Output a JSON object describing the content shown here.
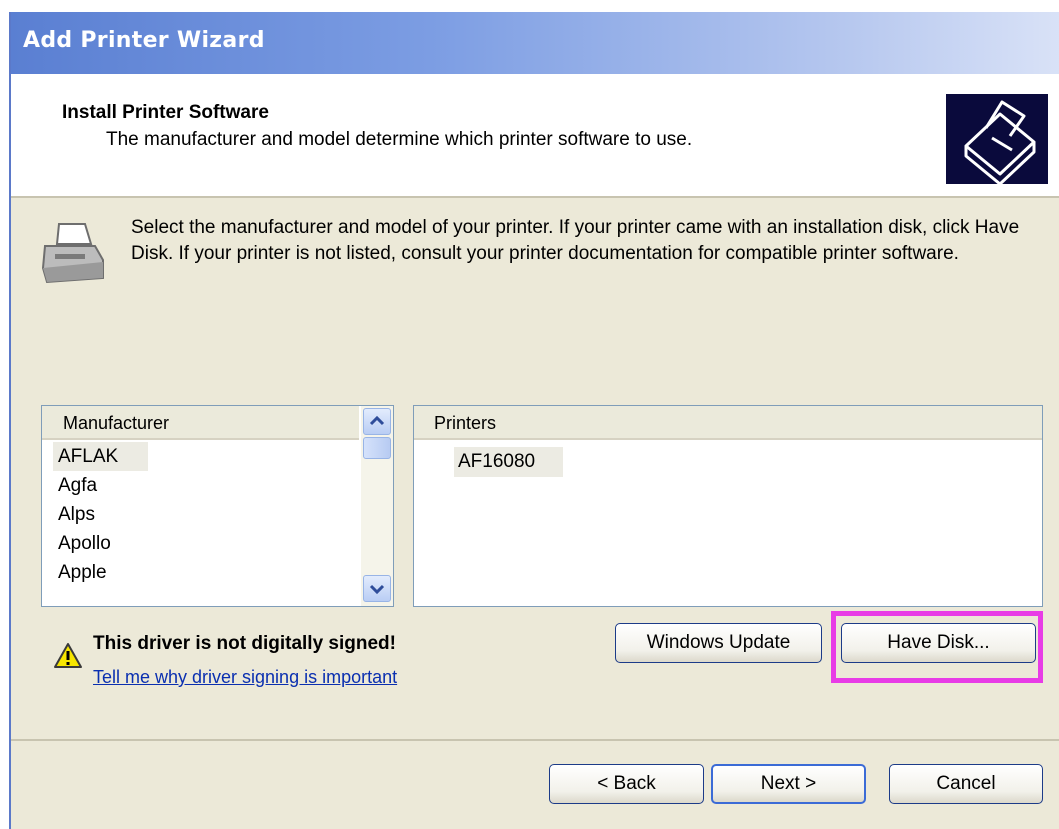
{
  "window": {
    "title": "Add Printer Wizard"
  },
  "header": {
    "title": "Install Printer Software",
    "subtitle": "The manufacturer and model determine which printer software to use.",
    "icon": "printer-wizard-graphic"
  },
  "intro": {
    "icon": "printer-icon",
    "text": "Select the manufacturer and model of your printer. If your printer came with an installation disk, click Have Disk. If your printer is not listed, consult your printer documentation for compatible printer software."
  },
  "manufacturer_list": {
    "header": "Manufacturer",
    "items": [
      {
        "label": "AFLAK",
        "selected": true
      },
      {
        "label": "Agfa"
      },
      {
        "label": "Alps"
      },
      {
        "label": "Apollo"
      },
      {
        "label": "Apple"
      }
    ]
  },
  "printers_list": {
    "header": "Printers",
    "items": [
      {
        "label": "AF16080",
        "selected": true
      }
    ]
  },
  "warning": {
    "icon": "warning-icon",
    "text": "This driver is not digitally signed!",
    "link": "Tell me why driver signing is important"
  },
  "buttons": {
    "windows_update": "Windows Update",
    "have_disk": "Have Disk...",
    "back": "< Back",
    "next": "Next >",
    "cancel": "Cancel"
  },
  "colors": {
    "highlight": "#e83ce6",
    "title_bar": "#5a7fd2",
    "dialog_bg": "#ece9d8"
  }
}
